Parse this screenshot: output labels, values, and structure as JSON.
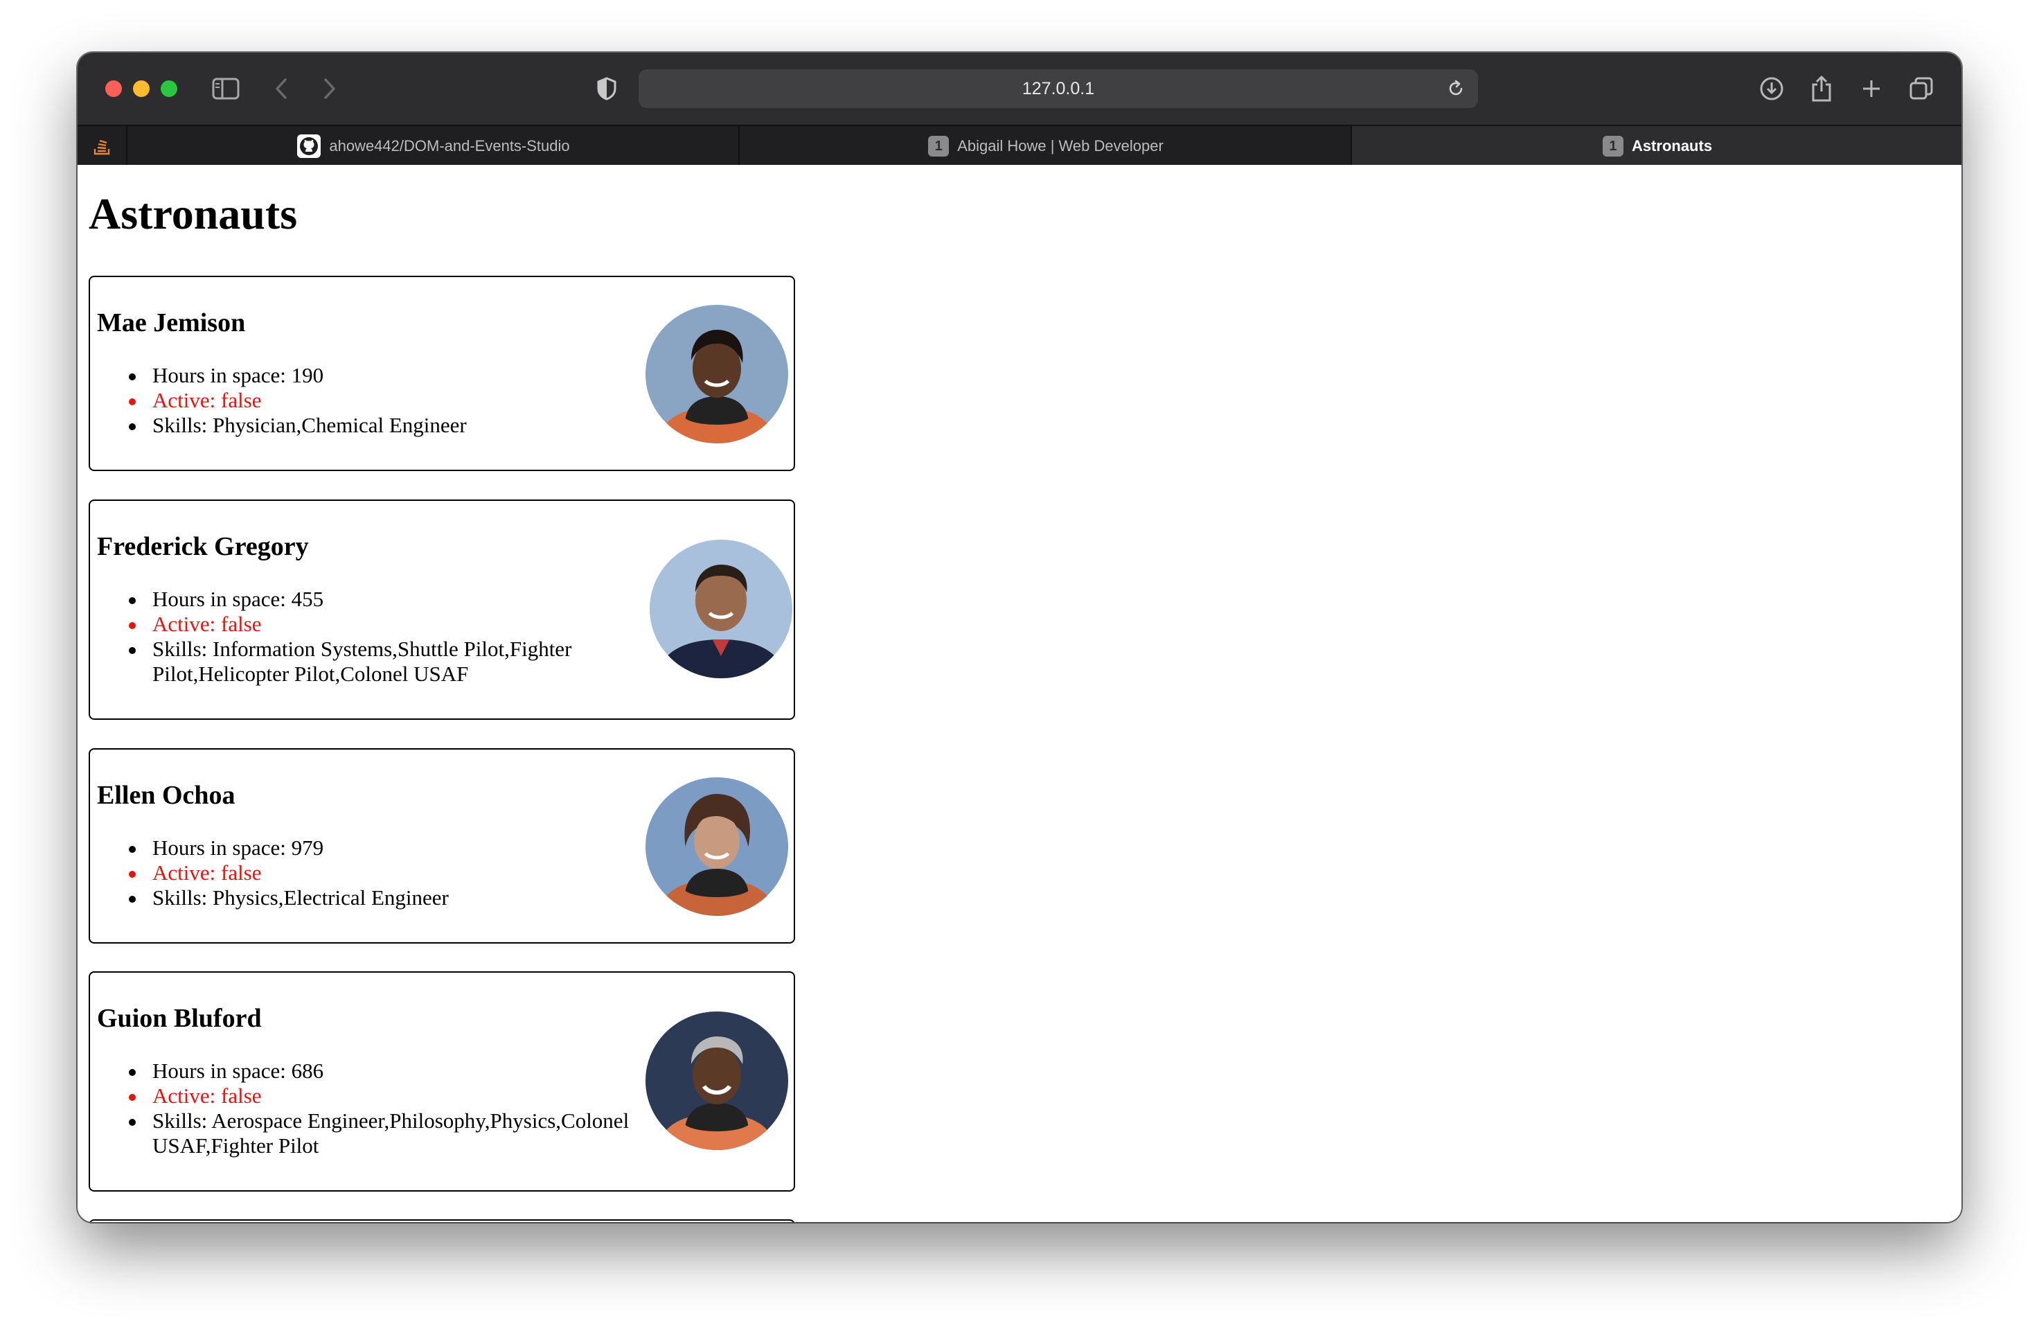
{
  "browser": {
    "url": "127.0.0.1",
    "tabs": [
      {
        "label": "ahowe442/DOM-and-Events-Studio",
        "icon": "github-icon",
        "active": false
      },
      {
        "label": "Abigail Howe | Web Developer",
        "badge": "1",
        "active": false
      },
      {
        "label": "Astronauts",
        "badge": "1",
        "active": true
      }
    ]
  },
  "page": {
    "title": "Astronauts",
    "astronauts": [
      {
        "name": "Mae Jemison",
        "hours": "Hours in space: 190",
        "active": "Active: false",
        "skills": "Skills: Physician,Chemical Engineer",
        "suit_color": "#d86a3c",
        "skin_color": "#5a3826",
        "hair_color": "#1a1210",
        "bg_color": "#8aa4c4"
      },
      {
        "name": "Frederick Gregory",
        "hours": "Hours in space: 455",
        "active": "Active: false",
        "skills": "Skills: Information Systems,Shuttle Pilot,Fighter Pilot,Helicopter Pilot,Colonel USAF",
        "suit_color": "#1c2440",
        "skin_color": "#9a6a4e",
        "hair_color": "#2a1e18",
        "bg_color": "#a8c0dc"
      },
      {
        "name": "Ellen Ochoa",
        "hours": "Hours in space: 979",
        "active": "Active: false",
        "skills": "Skills: Physics,Electrical Engineer",
        "suit_color": "#c8643a",
        "skin_color": "#c89a80",
        "hair_color": "#4a2e22",
        "bg_color": "#7c9cc4"
      },
      {
        "name": "Guion Bluford",
        "hours": "Hours in space: 686",
        "active": "Active: false",
        "skills": "Skills: Aerospace Engineer,Philosophy,Physics,Colonel USAF,Fighter Pilot",
        "suit_color": "#e07a4c",
        "skin_color": "#5c3a28",
        "hair_color": "#b8b8b8",
        "bg_color": "#2c3a56"
      }
    ]
  },
  "colors": {
    "inactive_text": "#e8130f",
    "toolbar_bg": "#2d2c2e",
    "tabbar_bg": "#1f1e20"
  }
}
